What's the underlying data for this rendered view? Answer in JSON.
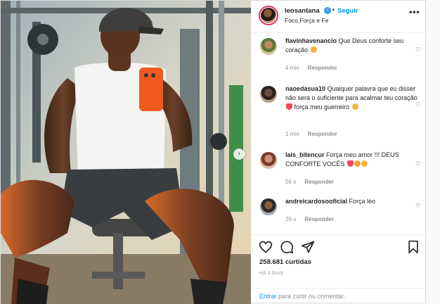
{
  "header": {
    "username": "leosantana",
    "dot": "•",
    "follow_label": "Seguir",
    "location": "Foco,Força e Fe"
  },
  "media": {
    "next_arrow": "›"
  },
  "comments": [
    {
      "username": "flavinhavenancio",
      "text": "Que Deus conforte seu coração",
      "emojis": [
        "folded-hands"
      ],
      "time": "4 min",
      "reply_label": "Responder"
    },
    {
      "username": "naoedasua10",
      "text": "Qualquer palavra que eu disser não será o suficiente para acalmar teu coração",
      "text2": " força meu guerreiro",
      "emojis": [
        "red-heart",
        "crying-face"
      ],
      "time": "1 min",
      "reply_label": "Responder"
    },
    {
      "username": "lais_bitencur",
      "text": "Força meu amor !!! DEUS CONFORTE VOCÊS",
      "emojis": [
        "red-heart",
        "smiling-face-hearts",
        "crying-face"
      ],
      "time": "56 s",
      "reply_label": "Responder"
    },
    {
      "username": "andreicardosooficial",
      "text": "Força léo",
      "emojis": [],
      "time": "20 s",
      "reply_label": "Responder"
    }
  ],
  "footer": {
    "likes": "258.681 curtidas",
    "time": "HÁ 3 DIAS",
    "login_link": "Entrar",
    "login_text": " para curtir ou comentar."
  },
  "colors": {
    "link_blue": "#0095f6",
    "verified_blue": "#3897f0",
    "meta_gray": "#8e8e8e",
    "heart_red": "#ed4956"
  }
}
